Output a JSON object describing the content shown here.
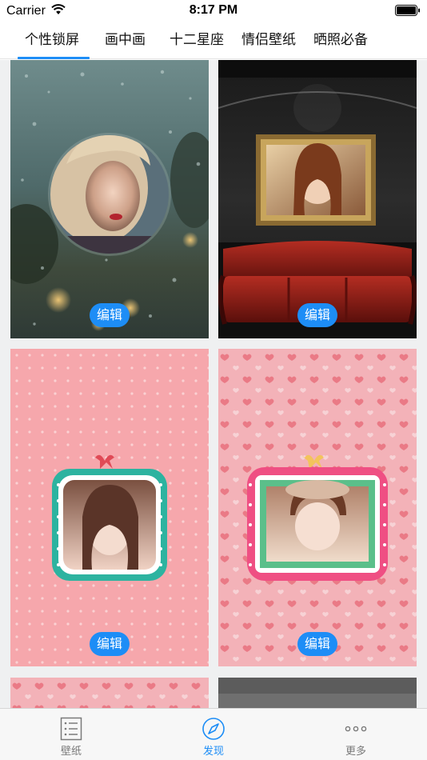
{
  "status_bar": {
    "carrier": "Carrier",
    "time": "8:17 PM"
  },
  "top_tabs": [
    {
      "label": "个性锁屏",
      "active": true
    },
    {
      "label": "画中画",
      "active": false
    },
    {
      "label": "十二星座",
      "active": false
    },
    {
      "label": "情侣壁纸",
      "active": false
    },
    {
      "label": "晒照必备",
      "active": false
    }
  ],
  "cards": [
    {
      "edit_label": "编辑",
      "theme": "rain-window-circle-portrait"
    },
    {
      "edit_label": "编辑",
      "theme": "gallery-frame-red-sofa"
    },
    {
      "edit_label": "编辑",
      "theme": "pink-dots-teal-frame"
    },
    {
      "edit_label": "编辑",
      "theme": "pink-hearts-pink-frame"
    }
  ],
  "bottom_tabs": [
    {
      "label": "壁纸",
      "icon": "list-icon",
      "active": false
    },
    {
      "label": "发现",
      "icon": "compass-icon",
      "active": true
    },
    {
      "label": "更多",
      "icon": "more-dots-icon",
      "active": false
    }
  ],
  "colors": {
    "accent": "#1d8df6",
    "tab_inactive": "#7a7a7a"
  }
}
